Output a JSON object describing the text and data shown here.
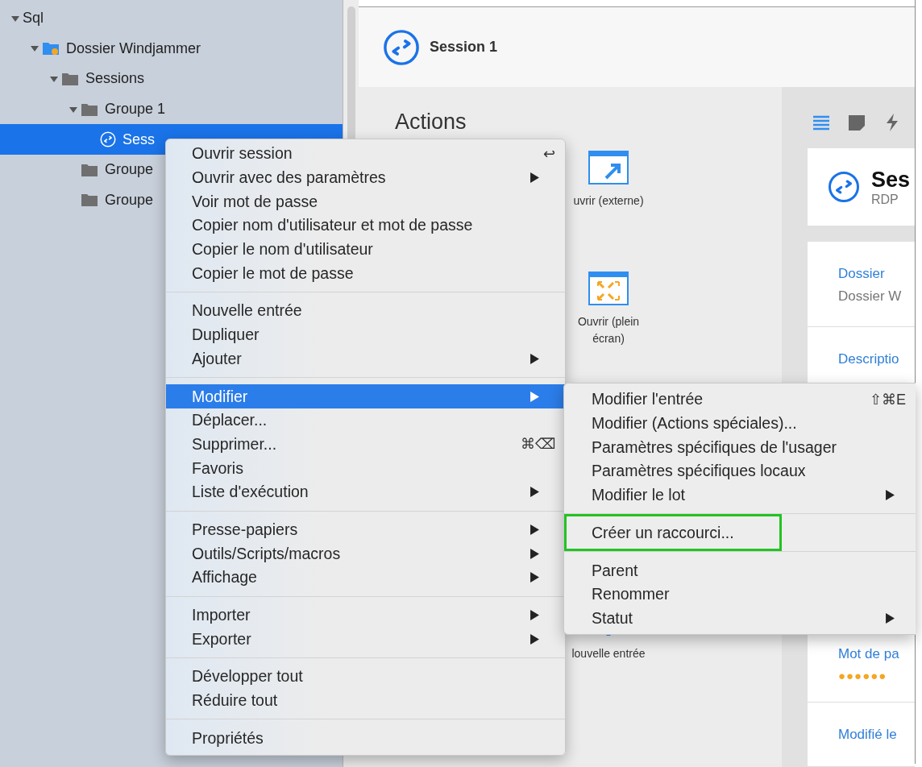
{
  "sidebar": {
    "tree": [
      {
        "label": "Sql",
        "expanded": true,
        "selected": false,
        "children": [
          {
            "label": "Dossier Windjammer",
            "kind": "vault",
            "expanded": true,
            "selected": false,
            "children": [
              {
                "label": "Sessions",
                "kind": "folder",
                "expanded": true,
                "selected": false,
                "children": [
                  {
                    "label": "Groupe 1",
                    "kind": "folder",
                    "expanded": true,
                    "selected": false,
                    "children": [
                      {
                        "label": "Sess",
                        "kind": "session",
                        "selected": true
                      }
                    ]
                  },
                  {
                    "label": "Groupe",
                    "kind": "folder",
                    "selected": false
                  },
                  {
                    "label": "Groupe",
                    "kind": "folder",
                    "selected": false
                  }
                ]
              }
            ]
          }
        ]
      }
    ]
  },
  "header": {
    "title": "Session 1"
  },
  "actions": {
    "title": "Actions",
    "items": [
      {
        "kind": "external",
        "label": "uvrir (externe)"
      },
      {
        "kind": "fullscreen",
        "label": "Ouvrir (plein écran)"
      },
      {
        "kind": "new",
        "label": "louvelle entrée"
      }
    ]
  },
  "details": {
    "entry": {
      "title": "Ses",
      "subtitle": "RDP"
    },
    "fields": [
      {
        "label": "Dossier",
        "value": "Dossier W"
      },
      {
        "label": "Descriptio"
      },
      {
        "label": "Mot de pa",
        "value": "●●●●●●",
        "kind": "password"
      },
      {
        "label": "Modifié le"
      }
    ]
  },
  "context_menu": {
    "sections": [
      [
        {
          "label": "Ouvrir session",
          "shortcut": "↩",
          "submenu": false,
          "selected": false
        },
        {
          "label": "Ouvrir avec des paramètres",
          "submenu": true,
          "selected": false
        },
        {
          "label": "Voir mot de passe",
          "submenu": false,
          "selected": false
        },
        {
          "label": "Copier nom d'utilisateur et mot de passe",
          "submenu": false,
          "selected": false
        },
        {
          "label": "Copier le nom d'utilisateur",
          "submenu": false,
          "selected": false
        },
        {
          "label": "Copier le mot de passe",
          "submenu": false,
          "selected": false
        }
      ],
      [
        {
          "label": "Nouvelle entrée",
          "submenu": false,
          "selected": false
        },
        {
          "label": "Dupliquer",
          "submenu": false,
          "selected": false
        },
        {
          "label": "Ajouter",
          "submenu": true,
          "selected": false
        }
      ],
      [
        {
          "label": "Modifier",
          "submenu": true,
          "selected": true
        },
        {
          "label": "Déplacer...",
          "submenu": false,
          "selected": false
        },
        {
          "label": "Supprimer...",
          "shortcut": "⌘⌫",
          "submenu": false,
          "selected": false
        },
        {
          "label": "Favoris",
          "submenu": false,
          "selected": false
        },
        {
          "label": "Liste d'exécution",
          "submenu": true,
          "selected": false
        }
      ],
      [
        {
          "label": "Presse-papiers",
          "submenu": true,
          "selected": false
        },
        {
          "label": "Outils/Scripts/macros",
          "submenu": true,
          "selected": false
        },
        {
          "label": "Affichage",
          "submenu": true,
          "selected": false
        }
      ],
      [
        {
          "label": "Importer",
          "submenu": true,
          "selected": false
        },
        {
          "label": "Exporter",
          "submenu": true,
          "selected": false
        }
      ],
      [
        {
          "label": "Développer tout",
          "submenu": false,
          "selected": false
        },
        {
          "label": "Réduire tout",
          "submenu": false,
          "selected": false
        }
      ],
      [
        {
          "label": "Propriétés",
          "submenu": false,
          "selected": false
        }
      ]
    ]
  },
  "submenu": {
    "sections": [
      [
        {
          "label": "Modifier l'entrée",
          "shortcut": "⇧⌘E",
          "submenu": false,
          "highlighted": false
        },
        {
          "label": "Modifier (Actions spéciales)...",
          "submenu": false,
          "highlighted": false
        },
        {
          "label": "Paramètres spécifiques de l'usager",
          "submenu": false,
          "highlighted": false
        },
        {
          "label": "Paramètres spécifiques locaux",
          "submenu": false,
          "highlighted": false
        },
        {
          "label": "Modifier le lot",
          "submenu": true,
          "highlighted": false
        }
      ],
      [
        {
          "label": "Créer un raccourci...",
          "submenu": false,
          "highlighted": true
        }
      ],
      [
        {
          "label": "Parent",
          "submenu": false,
          "highlighted": false
        },
        {
          "label": "Renommer",
          "submenu": false,
          "highlighted": false
        },
        {
          "label": "Statut",
          "submenu": true,
          "highlighted": false
        }
      ]
    ]
  }
}
